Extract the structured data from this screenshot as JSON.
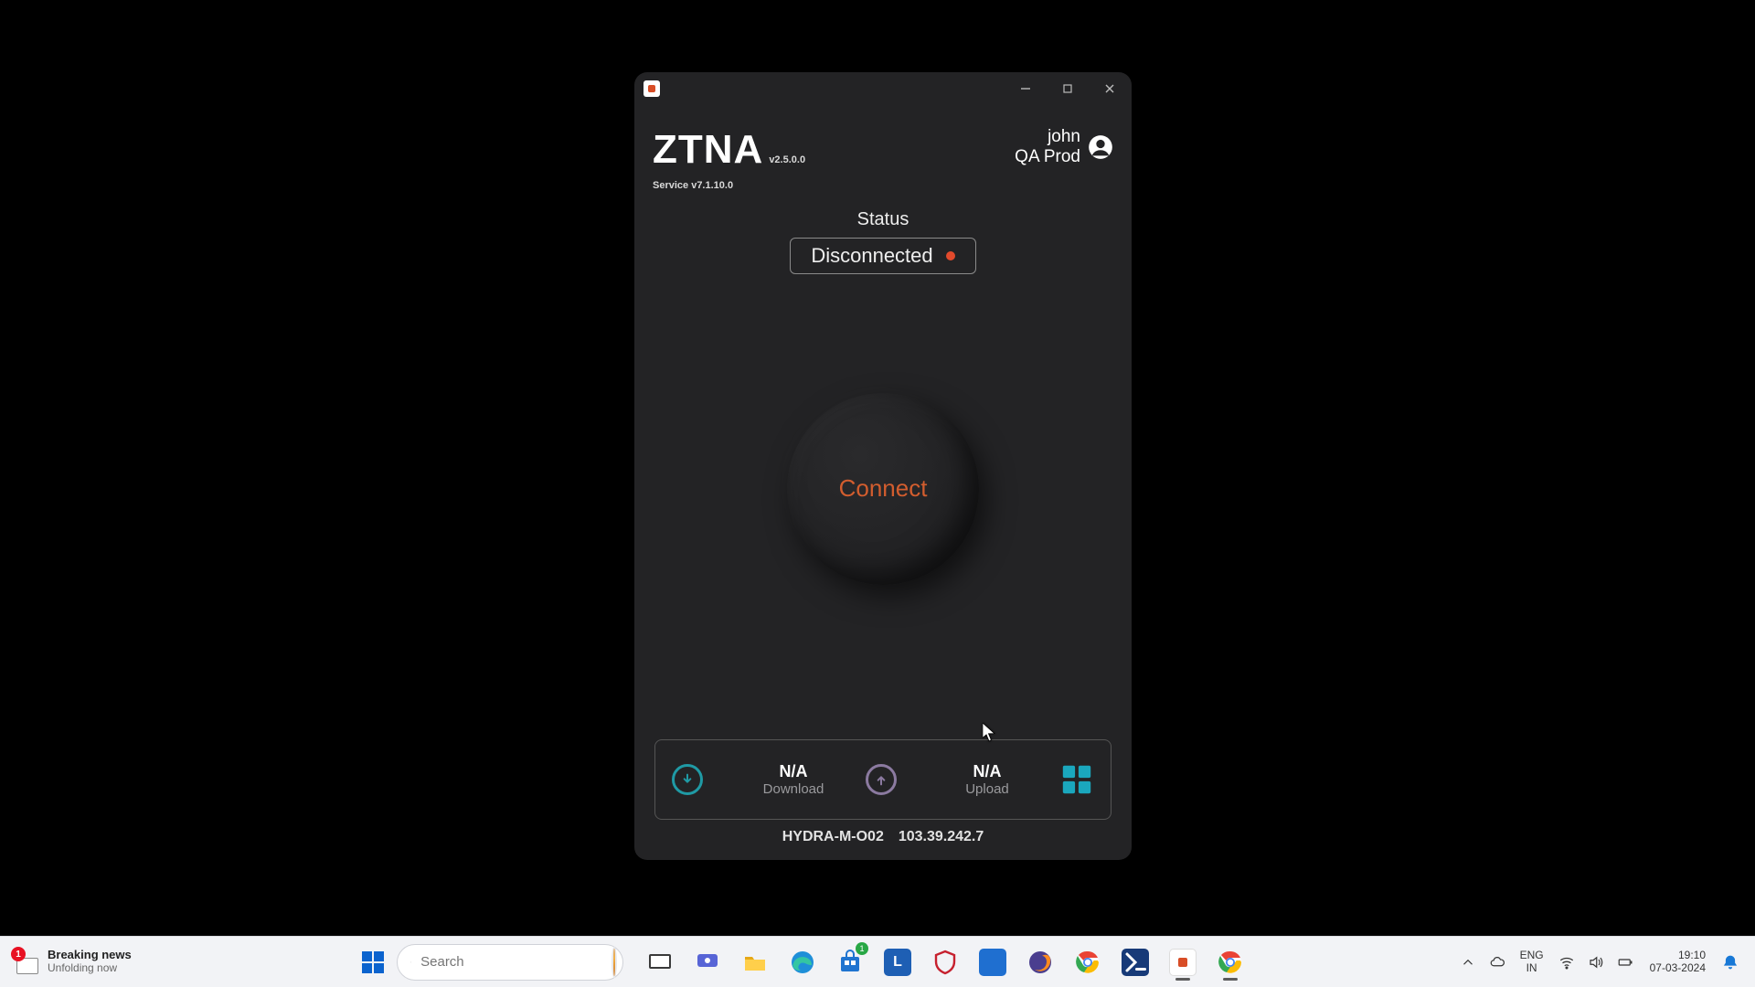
{
  "window": {
    "brand": "ZTNA",
    "brand_version": "v2.5.0.0",
    "service_version": "Service v7.1.10.0",
    "user": {
      "name": "john",
      "env": "QA Prod"
    },
    "status": {
      "label": "Status",
      "value": "Disconnected",
      "dot_color": "#e24a2c"
    },
    "connect_label": "Connect",
    "stats": {
      "download": {
        "value": "N/A",
        "label": "Download"
      },
      "upload": {
        "value": "N/A",
        "label": "Upload"
      }
    },
    "footer": {
      "host": "HYDRA-M-O02",
      "ip": "103.39.242.7"
    }
  },
  "taskbar": {
    "news": {
      "badge": "1",
      "title": "Breaking news",
      "subtitle": "Unfolding now"
    },
    "search_placeholder": "Search",
    "lang": {
      "code": "ENG",
      "region": "IN"
    },
    "clock": {
      "time": "19:10",
      "date": "07-03-2024"
    }
  }
}
